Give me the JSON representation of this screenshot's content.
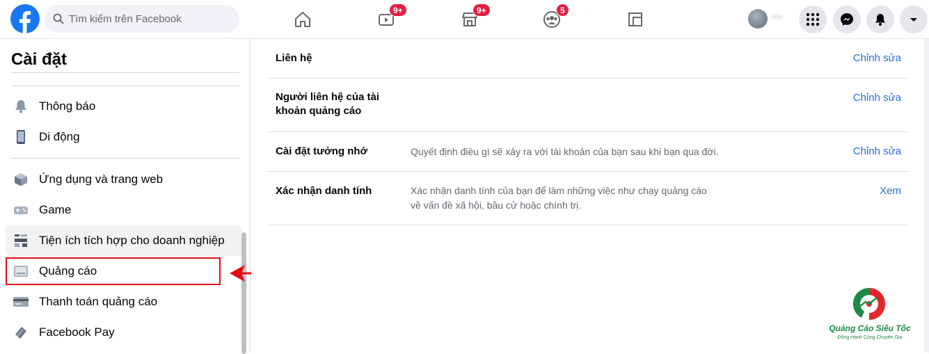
{
  "header": {
    "search_placeholder": "Tìm kiếm trên Facebook",
    "badges": {
      "watch": "9+",
      "marketplace": "9+",
      "groups": "5"
    },
    "profile_name": "***"
  },
  "sidebar": {
    "title": "Cài đặt",
    "items": [
      {
        "label": "Thông báo",
        "icon": "bell-icon"
      },
      {
        "label": "Di động",
        "icon": "phone-icon"
      },
      {
        "label": "Ứng dụng và trang web",
        "icon": "cube-icon"
      },
      {
        "label": "Game",
        "icon": "gamepad-icon"
      },
      {
        "label": "Tiện ích tích hợp cho doanh nghiệp",
        "icon": "puzzle-icon"
      },
      {
        "label": "Quảng cáo",
        "icon": "ads-icon"
      },
      {
        "label": "Thanh toán quảng cáo",
        "icon": "card-icon"
      },
      {
        "label": "Facebook Pay",
        "icon": "pay-icon"
      }
    ]
  },
  "main": {
    "rows": [
      {
        "label": "Liên hệ",
        "desc": "",
        "action": "Chỉnh sửa"
      },
      {
        "label": "Người liên hệ của tài khoản quảng cáo",
        "desc": "",
        "action": "Chỉnh sửa"
      },
      {
        "label": "Cài đặt tưởng nhớ",
        "desc": "Quyết định điều gì sẽ xảy ra với tài khoản của bạn sau khi bạn qua đời.",
        "action": "Chỉnh sửa"
      },
      {
        "label": "Xác nhận danh tính",
        "desc": "Xác nhận danh tính của bạn để làm những việc như chạy quảng cáo về vấn đề xã hội, bầu cử hoặc chính trị.",
        "action": "Xem"
      }
    ]
  },
  "watermark": {
    "brand": "Quảng Cáo Siêu Tốc",
    "tagline": "Đồng Hành Cùng Chuyên Gia"
  },
  "colors": {
    "facebook_blue": "#1877f2",
    "link_blue": "#216fdb",
    "badge_red": "#e41e3f",
    "highlight_red": "#e50914"
  }
}
